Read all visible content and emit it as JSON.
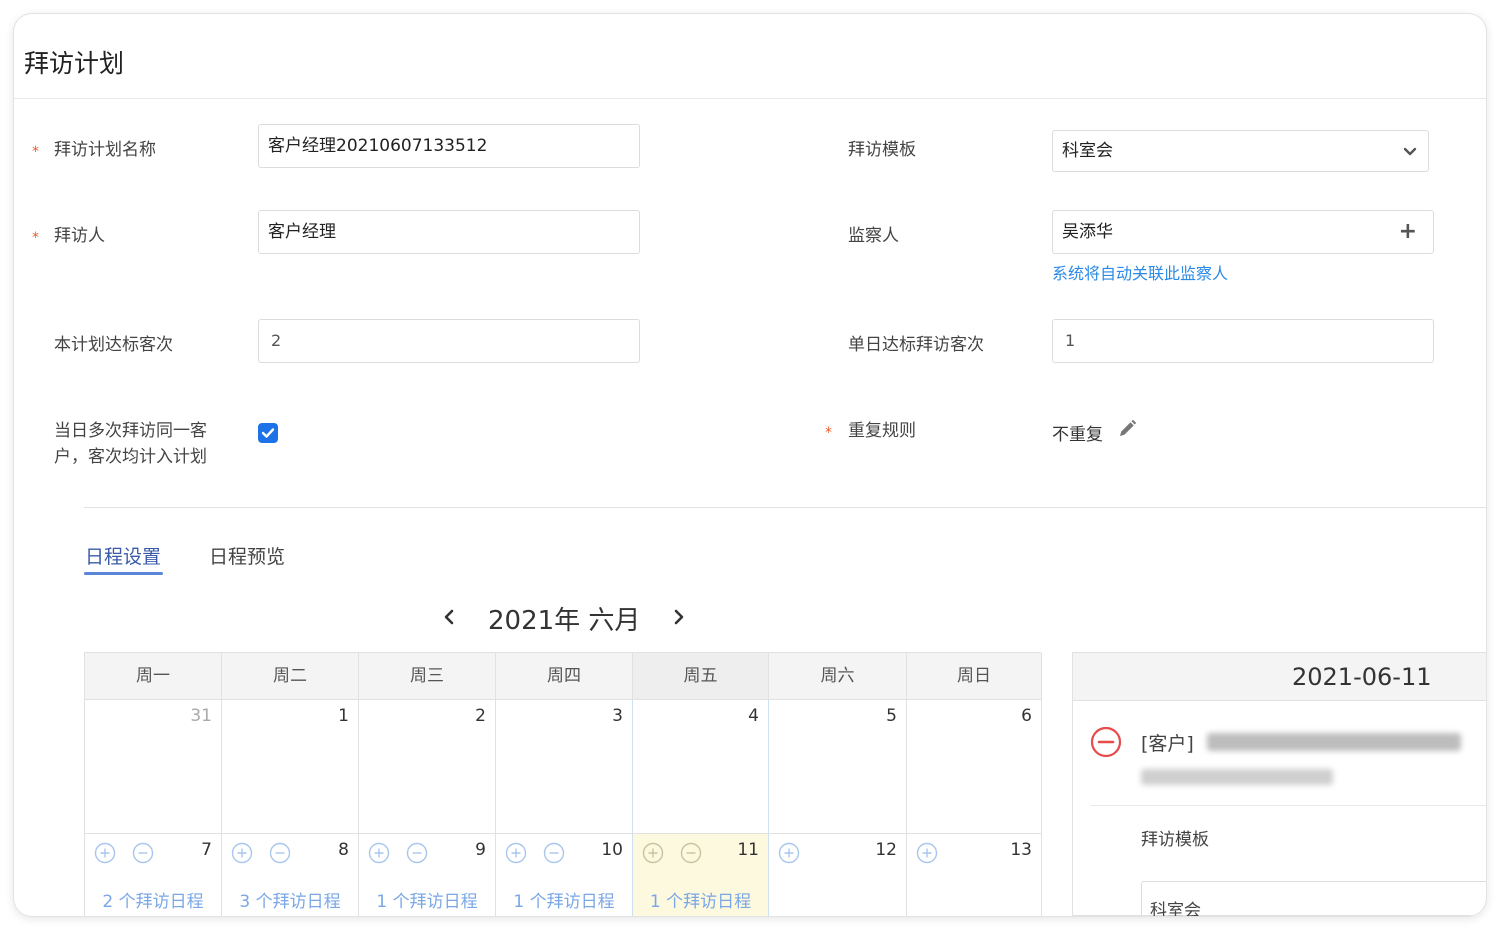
{
  "page": {
    "title": "拜访计划"
  },
  "form": {
    "plan_name": {
      "label": "拜访计划名称",
      "value": "客户经理20210607133512"
    },
    "template": {
      "label": "拜访模板",
      "value": "科室会"
    },
    "visitor": {
      "label": "拜访人",
      "value": "客户经理"
    },
    "supervisor": {
      "label": "监察人",
      "value": "吴添华",
      "hint": "系统将自动关联此监察人"
    },
    "target_visits": {
      "label": "本计划达标客次",
      "value": "2"
    },
    "daily_target": {
      "label": "单日达标拜访客次",
      "value": "1"
    },
    "multi_visit": {
      "label_line1": "当日多次拜访同一客",
      "label_line2": "户，客次均计入计划",
      "checked": true
    },
    "repeat_rule": {
      "label": "重复规则",
      "value": "不重复"
    },
    "required_mark": "*"
  },
  "tabs": [
    {
      "label": "日程设置",
      "active": true
    },
    {
      "label": "日程预览",
      "active": false
    }
  ],
  "calendar": {
    "month_title": "2021年 六月",
    "weekdays": [
      "周一",
      "周二",
      "周三",
      "周四",
      "周五",
      "周六",
      "周日"
    ],
    "week1": [
      "31",
      "1",
      "2",
      "3",
      "4",
      "5",
      "6"
    ],
    "week2": [
      {
        "day": "7",
        "schedule": "2 个拜访日程"
      },
      {
        "day": "8",
        "schedule": "3 个拜访日程"
      },
      {
        "day": "9",
        "schedule": "1 个拜访日程"
      },
      {
        "day": "10",
        "schedule": "1 个拜访日程"
      },
      {
        "day": "11",
        "schedule": "1 个拜访日程"
      },
      {
        "day": "12",
        "schedule": ""
      },
      {
        "day": "13",
        "schedule": ""
      }
    ]
  },
  "detail_panel": {
    "date": "2021-06-11",
    "customer_tag": "[客户]",
    "template_label": "拜访模板",
    "template_value": "科室会"
  },
  "colors": {
    "accent": "#1d72e8",
    "link": "#2b8ae6",
    "required": "#f05a28",
    "today": "#fdf9de",
    "remove": "#e64a4a"
  }
}
